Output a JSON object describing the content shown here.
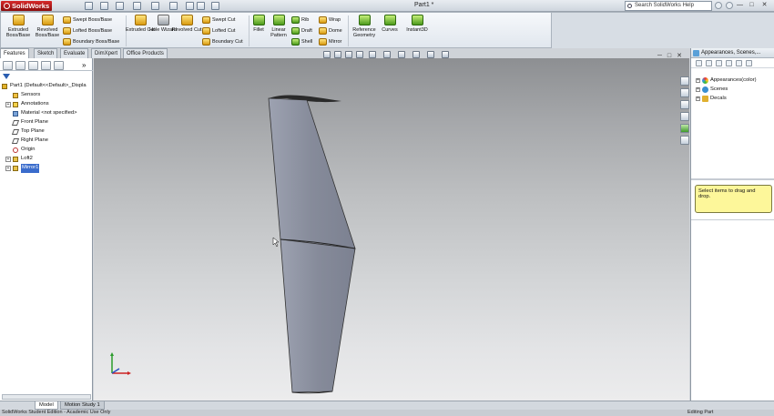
{
  "app": {
    "logo_text": "SolidWorks",
    "document_title": "Part1 *",
    "help_search_placeholder": "Search SolidWorks Help",
    "window_controls": [
      "—",
      "□",
      "✕"
    ]
  },
  "ribbon": {
    "large_buttons": [
      {
        "label": "Extruded Boss/Base",
        "icon": "extrude-boss-icon"
      },
      {
        "label": "Revolved Boss/Base",
        "icon": "revolve-boss-icon"
      },
      {
        "label": "Extruded Cut",
        "icon": "extrude-cut-icon"
      },
      {
        "label": "Hole Wizard",
        "icon": "hole-wizard-icon"
      },
      {
        "label": "Revolved Cut",
        "icon": "revolve-cut-icon"
      },
      {
        "label": "Fillet",
        "icon": "fillet-icon"
      },
      {
        "label": "Linear Pattern",
        "icon": "linear-pattern-icon"
      },
      {
        "label": "Reference Geometry",
        "icon": "reference-geometry-icon"
      },
      {
        "label": "Curves",
        "icon": "curves-icon"
      },
      {
        "label": "Instant3D",
        "icon": "instant3d-icon"
      }
    ],
    "small_buttons": {
      "swept_boss": "Swept Boss/Base",
      "lofted_boss": "Lofted Boss/Base",
      "boundary_boss": "Boundary Boss/Base",
      "swept_cut": "Swept Cut",
      "lofted_cut": "Lofted Cut",
      "boundary_cut": "Boundary Cut",
      "rib": "Rib",
      "draft": "Draft",
      "shell": "Shell",
      "wrap": "Wrap",
      "dome": "Dome",
      "mirror": "Mirror"
    }
  },
  "command_tabs": [
    "Features",
    "Sketch",
    "Evaluate",
    "DimXpert",
    "Office Products"
  ],
  "feature_tree": {
    "root": "Part1  (Default<<Default>_Displa",
    "items": [
      {
        "label": "Sensors",
        "icon": "sensors-icon",
        "expandable": false
      },
      {
        "label": "Annotations",
        "icon": "annotations-icon",
        "expandable": true
      },
      {
        "label": "Material <not specified>",
        "icon": "material-icon",
        "expandable": false
      },
      {
        "label": "Front Plane",
        "icon": "plane-icon",
        "expandable": false
      },
      {
        "label": "Top Plane",
        "icon": "plane-icon",
        "expandable": false
      },
      {
        "label": "Right Plane",
        "icon": "plane-icon",
        "expandable": false
      },
      {
        "label": "Origin",
        "icon": "origin-icon",
        "expandable": false
      },
      {
        "label": "Loft2",
        "icon": "loft-icon",
        "expandable": true
      },
      {
        "label": "Mirror1",
        "icon": "mirror-feature-icon",
        "expandable": true,
        "selected": true
      }
    ]
  },
  "bottom_tabs": [
    "Model",
    "Motion Study 1"
  ],
  "status": {
    "left": "SolidWorks Student Edition - Academic Use Only",
    "right": "Editing Part"
  },
  "task_pane": {
    "title": "Appearances, Scenes,...",
    "items": [
      {
        "label": "Appearances(color)",
        "icon": "appearances-icon"
      },
      {
        "label": "Scenes",
        "icon": "scenes-icon"
      },
      {
        "label": "Decals",
        "icon": "decals-icon"
      }
    ],
    "message": "Select items to drag and drop."
  },
  "colors": {
    "part_fill": "#878b99",
    "selection": "#3a6ccc",
    "tooltip_bg": "#fdf79a"
  }
}
